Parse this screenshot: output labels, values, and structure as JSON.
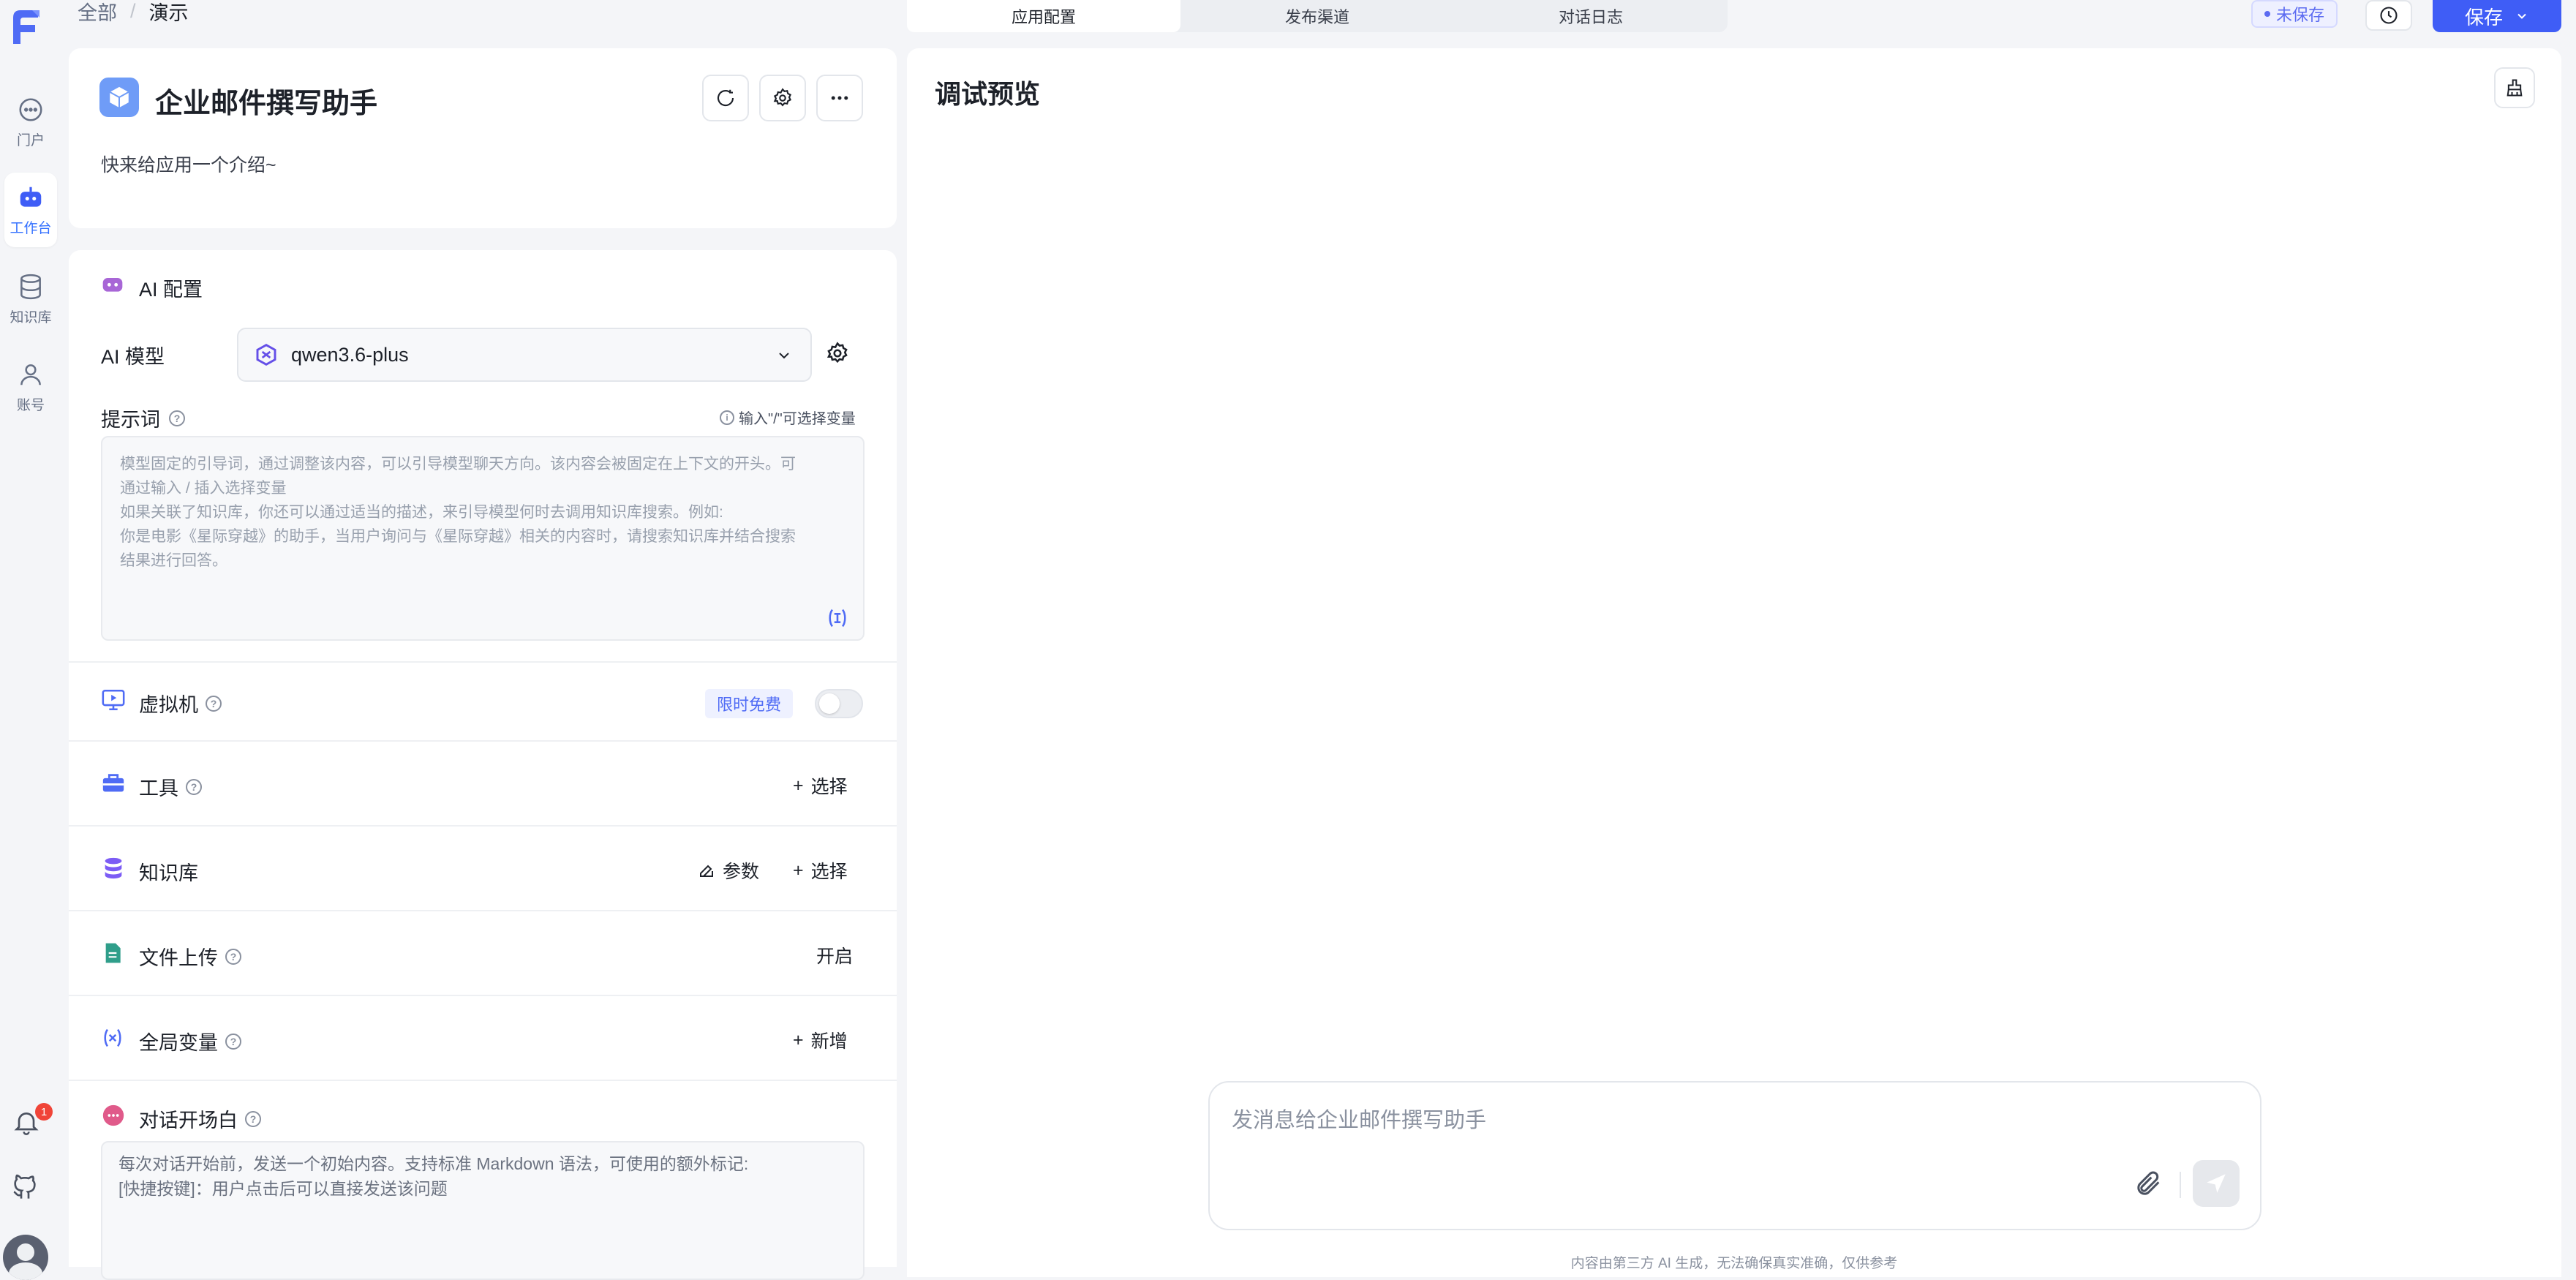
{
  "breadcrumb": {
    "root": "全部",
    "sep": "/",
    "current": "演示"
  },
  "nav": [
    {
      "label": "门户",
      "icon": "chat-bubble-icon"
    },
    {
      "label": "工作台",
      "icon": "robot-icon",
      "active": true
    },
    {
      "label": "知识库",
      "icon": "database-icon"
    },
    {
      "label": "账号",
      "icon": "user-icon"
    }
  ],
  "notifications": {
    "count": "1"
  },
  "tabs": [
    {
      "label": "应用配置",
      "active": true
    },
    {
      "label": "发布渠道"
    },
    {
      "label": "对话日志"
    }
  ],
  "header": {
    "unsaved_label": "未保存",
    "save_label": "保存"
  },
  "app": {
    "name": "企业邮件撰写助手",
    "intro": "快来给应用一个介绍~"
  },
  "ai_config": {
    "title": "AI 配置",
    "model_label": "AI 模型",
    "model_value": "qwen3.6-plus",
    "prompt_label": "提示词",
    "prompt_hint": "输入\"/\"可选择变量",
    "prompt_placeholder_lines": [
      "模型固定的引导词，通过调整该内容，可以引导模型聊天方向。该内容会被固定在上下文的开头。可",
      "通过输入 / 插入选择变量",
      "如果关联了知识库，你还可以通过适当的描述，来引导模型何时去调用知识库搜索。例如:",
      "你是电影《星际穿越》的助手，当用户询问与《星际穿越》相关的内容时，请搜索知识库并结合搜索",
      "结果进行回答。"
    ]
  },
  "sections": {
    "vm": {
      "title": "虚拟机",
      "badge": "限时免费"
    },
    "tools": {
      "title": "工具",
      "action": "选择"
    },
    "kb": {
      "title": "知识库",
      "param": "参数",
      "action": "选择"
    },
    "file_upload": {
      "title": "文件上传",
      "action": "开启"
    },
    "globals": {
      "title": "全局变量",
      "action": "新增"
    },
    "opening": {
      "title": "对话开场白",
      "placeholder_lines": [
        "每次对话开始前，发送一个初始内容。支持标准 Markdown 语法，可使用的额外标记:",
        "[快捷按键]：用户点击后可以直接发送该问题"
      ]
    }
  },
  "preview": {
    "title": "调试预览",
    "input_placeholder": "发消息给企业邮件撰写助手",
    "footer": "内容由第三方 AI 生成，无法确保真实准确，仅供参考"
  },
  "colors": {
    "accent": "#3f5df6",
    "brand": "#4f6bf5",
    "badge_red": "#f04438"
  }
}
